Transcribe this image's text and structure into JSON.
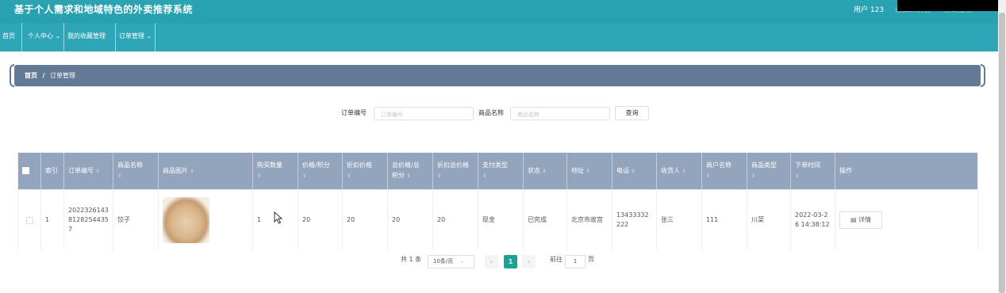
{
  "header": {
    "app_title": "基于个人需求和地域特色的外卖推荐系统",
    "user": "用户 123",
    "link1": "退出到前台",
    "link2": "退出登录"
  },
  "nav": {
    "items": [
      {
        "label": "首页"
      },
      {
        "label": "个人中心 ⌄"
      },
      {
        "label": "我的收藏管理 ⌄"
      },
      {
        "label": "订单管理 ⌄"
      }
    ]
  },
  "breadcrumb": {
    "home": "首页",
    "sep": "/",
    "current": "订单管理"
  },
  "search": {
    "order_no_label": "订单编号",
    "order_no_placeholder": "订单编号",
    "goods_name_label": "商品名称",
    "goods_name_placeholder": "商品名称",
    "query_button": "查询"
  },
  "table": {
    "headers": {
      "index": "索引",
      "order_no": "订单编号",
      "goods_name": "商品名称",
      "goods_image": "商品图片",
      "quantity": "购买数量",
      "price": "价格/积分",
      "discount_price": "折扣价格",
      "total": "总价格/总积分",
      "discount_total": "折扣总价格",
      "pay_type": "支付类型",
      "status": "状态",
      "address": "地址",
      "phone": "电话",
      "receiver": "收货人",
      "merchant": "商户名称",
      "goods_type": "商品类型",
      "order_time": "下单时间",
      "actions": "操作"
    },
    "rows": [
      {
        "index": "1",
        "order_no": "202232614381282544357",
        "goods_name": "饺子",
        "quantity": "1",
        "price": "20",
        "discount_price": "20",
        "total": "20",
        "discount_total": "20",
        "pay_type": "现金",
        "status": "已完成",
        "address": "北京市故宫",
        "phone": "13433332222",
        "receiver": "张三",
        "merchant": "111",
        "goods_type": "川菜",
        "order_time": "2022-03-26 14:38:12",
        "detail_button": "详情"
      }
    ]
  },
  "pagination": {
    "total": "共 1 条",
    "page_size": "10条/页",
    "current_page": "1",
    "goto_label": "前往",
    "goto_value": "1",
    "page_suffix": "页"
  },
  "colors": {
    "header_bg": "#2aa3b3",
    "breadcrumb_bg": "#637a96",
    "table_header_bg": "#93a4bd",
    "pager_active": "#1aa392"
  }
}
